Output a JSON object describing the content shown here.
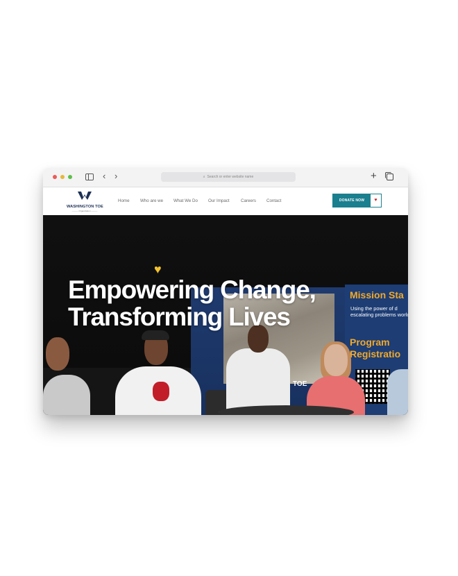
{
  "browser": {
    "address_placeholder": "Search or enter website name",
    "icons": [
      "sidebar-icon",
      "back-icon",
      "forward-icon",
      "search-icon",
      "new-tab-icon",
      "tabs-overview-icon"
    ]
  },
  "site": {
    "logo": {
      "name": "WASHINGTON TOE",
      "tagline": "———  Organization  ———"
    },
    "nav": [
      "Home",
      "Who are we",
      "What We Do",
      "Our Impact",
      "Careers",
      "Contact"
    ],
    "donate_label": "DONATE NOW",
    "donate_icon": "heart-icon"
  },
  "hero": {
    "title_line1": "Empowering Change,",
    "title_line2": "Transforming Lives",
    "accent_icon": "heart-icon",
    "banner": {
      "mission_title": "Mission Sta",
      "mission_text": "Using the power of d escalating problems world.",
      "program_title": "Program Registratio",
      "backdrop_label": "TOE"
    }
  },
  "colors": {
    "accent_teal": "#1a7f8e",
    "heart_red": "#c8262d",
    "hero_heart_yellow": "#f2c12e",
    "banner_orange": "#f1a92b",
    "banner_blue": "#1d3d74",
    "logo_navy": "#1c2f55"
  }
}
